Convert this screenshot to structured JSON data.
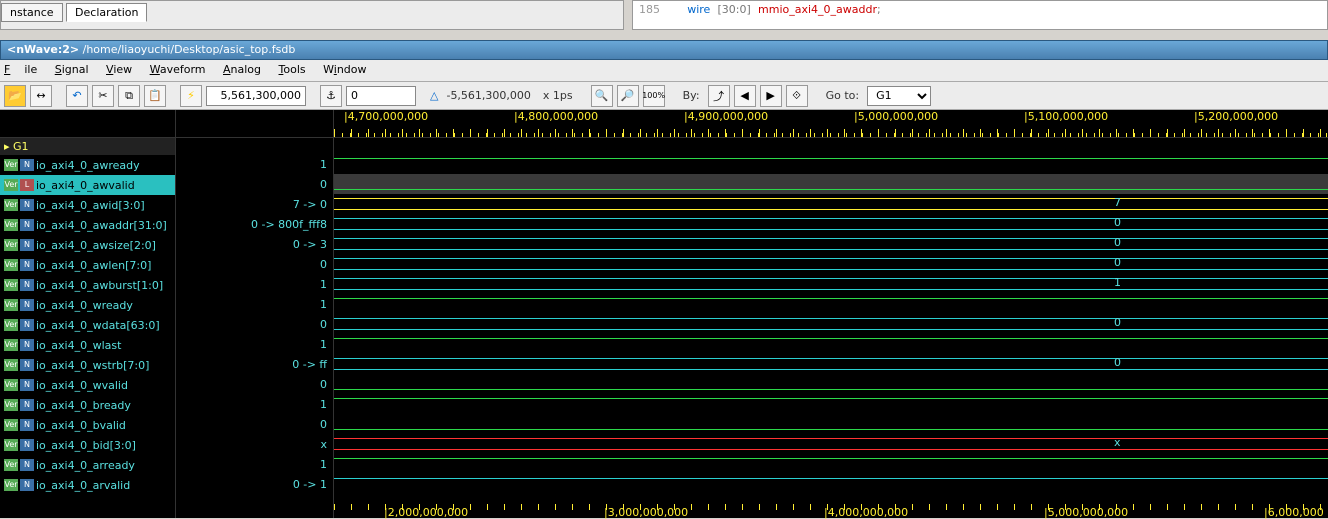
{
  "top_tabs": {
    "instance": "nstance",
    "declaration": "Declaration"
  },
  "code_line": {
    "num": "185",
    "kw": "wire",
    "range": "[30:0]",
    "ident": "mmio_axi4_0_awaddr",
    "tail": ";"
  },
  "title": {
    "app": "<nWave:2>",
    "path": "/home/liaoyuchi/Desktop/asic_top.fsdb"
  },
  "menu": {
    "file": "File",
    "signal": "Signal",
    "view": "View",
    "waveform": "Waveform",
    "analog": "Analog",
    "tools": "Tools",
    "window": "Window"
  },
  "toolbar": {
    "cursor_time": "5,561,300,000",
    "marker_time": "0",
    "delta": "-5,561,300,000",
    "unit": "x 1ps",
    "by": "By:",
    "goto": "Go to:",
    "goto_val": "G1"
  },
  "ruler_ticks": [
    "4,700,000,000",
    "4,800,000,000",
    "4,900,000,000",
    "5,000,000,000",
    "5,100,000,000",
    "5,200,000,000"
  ],
  "ruler_bot": [
    "2,000,000,000",
    "3,000,000,000",
    "4,000,000,000",
    "5,000,000,000",
    "6,000,000"
  ],
  "group": "G1",
  "signals": [
    {
      "name": "io_axi4_0_awready",
      "val": "1",
      "type": "bit",
      "color": "green",
      "level": "hi",
      "center": "",
      "sel": false
    },
    {
      "name": "io_axi4_0_awvalid",
      "val": "0",
      "type": "bit",
      "color": "green",
      "level": "lo",
      "center": "",
      "sel": true,
      "hl": true
    },
    {
      "name": "io_axi4_0_awid[3:0]",
      "val": "7 -> 0",
      "type": "bus",
      "color": "yellow",
      "center": "7",
      "sel": false
    },
    {
      "name": "io_axi4_0_awaddr[31:0]",
      "val": "0 -> 800f_fff8",
      "type": "bus",
      "color": "cyan",
      "center": "0",
      "sel": false
    },
    {
      "name": "io_axi4_0_awsize[2:0]",
      "val": "0 -> 3",
      "type": "bus",
      "color": "cyan",
      "center": "0",
      "sel": false
    },
    {
      "name": "io_axi4_0_awlen[7:0]",
      "val": "0",
      "type": "bus",
      "color": "cyan",
      "center": "0",
      "sel": false
    },
    {
      "name": "io_axi4_0_awburst[1:0]",
      "val": "1",
      "type": "bus",
      "color": "cyan",
      "center": "1",
      "sel": false
    },
    {
      "name": "io_axi4_0_wready",
      "val": "1",
      "type": "bit",
      "color": "green",
      "level": "hi",
      "center": "",
      "sel": false
    },
    {
      "name": "io_axi4_0_wdata[63:0]",
      "val": "0",
      "type": "bus",
      "color": "cyan",
      "center": "0",
      "sel": false,
      "tall": true
    },
    {
      "name": "io_axi4_0_wlast",
      "val": "1",
      "type": "bit",
      "color": "green",
      "level": "hi",
      "center": "",
      "sel": false
    },
    {
      "name": "io_axi4_0_wstrb[7:0]",
      "val": "0 -> ff",
      "type": "bus",
      "color": "cyan",
      "center": "0",
      "sel": false
    },
    {
      "name": "io_axi4_0_wvalid",
      "val": "0",
      "type": "bit",
      "color": "green",
      "level": "lo",
      "center": "",
      "sel": false
    },
    {
      "name": "io_axi4_0_bready",
      "val": "1",
      "type": "bit",
      "color": "green",
      "level": "hi",
      "center": "",
      "sel": false
    },
    {
      "name": "io_axi4_0_bvalid",
      "val": "0",
      "type": "bit",
      "color": "green",
      "level": "lo",
      "center": "",
      "sel": false
    },
    {
      "name": "io_axi4_0_bid[3:0]",
      "val": "x",
      "type": "bus",
      "color": "red",
      "center": "x",
      "sel": false
    },
    {
      "name": "io_axi4_0_arready",
      "val": "1",
      "type": "bit",
      "color": "green",
      "level": "hi",
      "center": "",
      "sel": false
    },
    {
      "name": "io_axi4_0_arvalid",
      "val": "0 -> 1",
      "type": "bit",
      "color": "cyan",
      "level": "hi",
      "center": "",
      "sel": false
    }
  ]
}
